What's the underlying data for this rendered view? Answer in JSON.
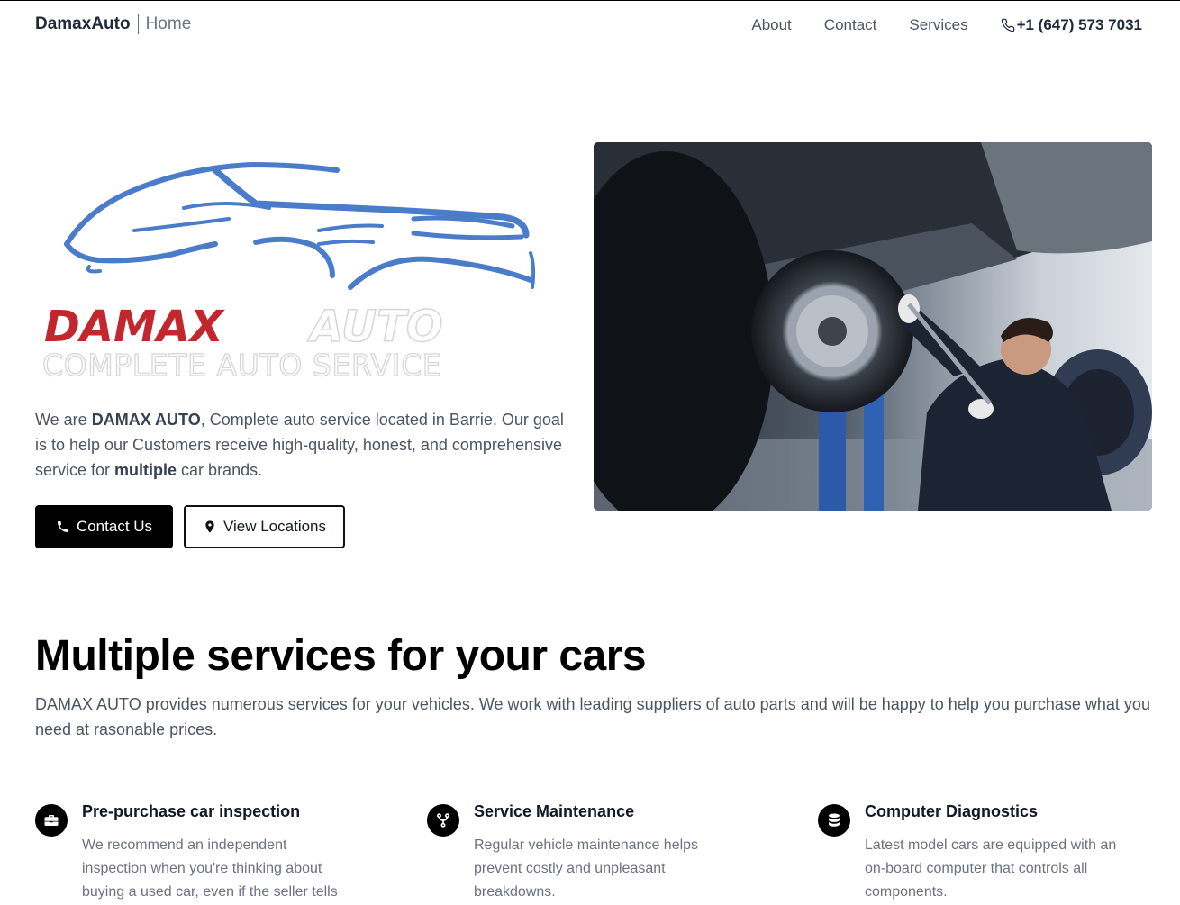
{
  "header": {
    "brand": "DamaxAuto",
    "page": "Home",
    "links": [
      "About",
      "Contact",
      "Services"
    ],
    "phone": "+1 (647) 573 7031",
    "phone_icon": "phone-icon"
  },
  "hero": {
    "logo": {
      "name": "DAMAX",
      "name_suffix": "AUTO",
      "tagline": "COMPLETE AUTO SERVICE",
      "colors": {
        "car": "#4a7cc9",
        "damax": "#c2272d",
        "auto": "#d6d6d6"
      }
    },
    "text_parts": {
      "p1": "We are ",
      "b1": "DAMAX AUTO",
      "p2": ", Complete auto service located in Barrie. Our goal is to help our Customers receive high-quality, honest, and comprehensive service for ",
      "b2": "multiple",
      "p3": " car brands."
    },
    "primary_button": {
      "label": "Contact Us",
      "icon": "phone-icon"
    },
    "secondary_button": {
      "label": "View Locations",
      "icon": "location-pin-icon"
    },
    "photo": "mechanic working under lifted car"
  },
  "services": {
    "title": "Multiple services for your cars",
    "description": "DAMAX AUTO provides numerous services for your vehicles. We work with leading suppliers of auto parts and will be happy to help you purchase what you need at rasonable prices.",
    "items": [
      {
        "title": "Pre-purchase car inspection",
        "text": "We recommend an independent inspection when you're thinking about buying a used car, even if the seller tells",
        "icon": "briefcase-icon"
      },
      {
        "title": "Service Maintenance",
        "text": "Regular vehicle maintenance helps prevent costly and unpleasant breakdowns.",
        "icon": "fork-icon"
      },
      {
        "title": "Computer Diagnostics",
        "text": "Latest model cars are equipped with an on-board computer that controls all components.",
        "icon": "database-icon"
      }
    ]
  }
}
